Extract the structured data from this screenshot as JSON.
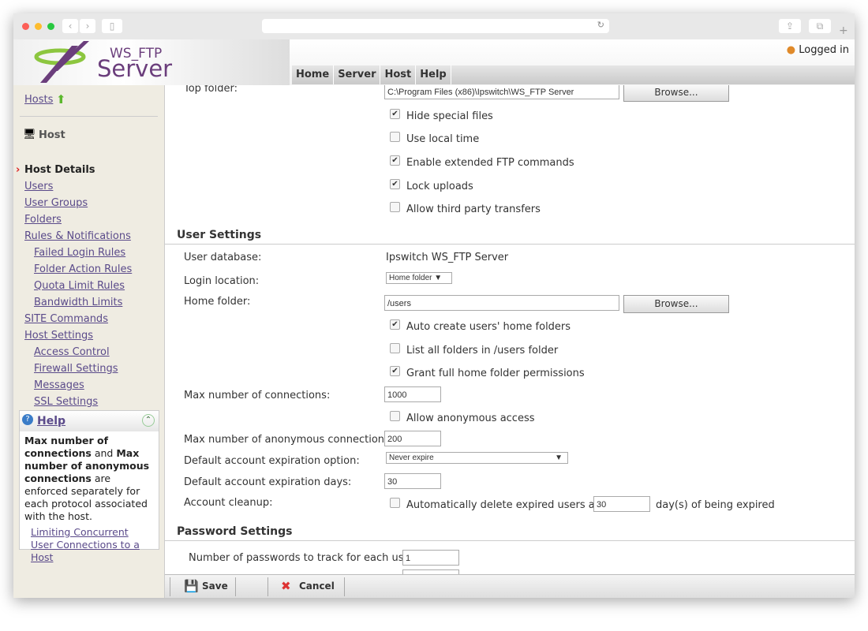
{
  "app": {
    "logo_line1": "WS_FTP",
    "logo_line2": "Server",
    "logged_in": "Logged in"
  },
  "nav": [
    "Home",
    "Server",
    "Host",
    "Help"
  ],
  "sidebar": {
    "hosts": "Hosts",
    "host_header": "Host",
    "items": [
      {
        "label": "Host Details",
        "level": 0,
        "current": true
      },
      {
        "label": "Users",
        "level": 0
      },
      {
        "label": "User Groups",
        "level": 0
      },
      {
        "label": "Folders",
        "level": 0
      },
      {
        "label": "Rules & Notifications",
        "level": 0
      },
      {
        "label": "Failed Login Rules",
        "level": 1
      },
      {
        "label": "Folder Action Rules",
        "level": 1
      },
      {
        "label": "Quota Limit Rules",
        "level": 1
      },
      {
        "label": "Bandwidth Limits",
        "level": 1
      },
      {
        "label": "SITE Commands",
        "level": 0
      },
      {
        "label": "Host Settings",
        "level": 0
      },
      {
        "label": "Access Control",
        "level": 1
      },
      {
        "label": "Firewall Settings",
        "level": 1
      },
      {
        "label": "Messages",
        "level": 1
      },
      {
        "label": "SSL Settings",
        "level": 1
      }
    ]
  },
  "help": {
    "title": "Help",
    "b1": "Max number of connections",
    "t1": " and ",
    "b2": "Max number of anonymous connections",
    "t2": " are enforced separately for each protocol associated with the host.",
    "link": "Limiting Concurrent User Connections to a Host"
  },
  "form": {
    "top_folder_label": "Top folder:",
    "top_folder_value": "C:\\Program Files (x86)\\Ipswitch\\WS_FTP Server",
    "browse": "Browse...",
    "top_checks": [
      {
        "label": "Hide special files",
        "checked": true
      },
      {
        "label": "Use local time",
        "checked": false
      },
      {
        "label": "Enable extended FTP commands",
        "checked": true
      },
      {
        "label": "Lock uploads",
        "checked": true
      },
      {
        "label": "Allow third party transfers",
        "checked": false
      }
    ],
    "user_settings": "User Settings",
    "user_db_label": "User database:",
    "user_db_value": "Ipswitch WS_FTP Server",
    "login_loc_label": "Login location:",
    "login_loc_value": "Home folder ▼",
    "home_folder_label": "Home folder:",
    "home_folder_value": "/users",
    "home_checks": [
      {
        "label": "Auto create users' home folders",
        "checked": true
      },
      {
        "label": "List all folders in /users folder",
        "checked": false
      },
      {
        "label": "Grant full home folder permissions",
        "checked": true
      }
    ],
    "max_conn_label": "Max number of connections:",
    "max_conn_value": "1000",
    "anon_label": "Allow anonymous access",
    "anon_checked": false,
    "max_anon_label": "Max number of anonymous connections:",
    "max_anon_value": "200",
    "exp_opt_label": "Default account expiration option:",
    "exp_opt_value": "Never expire",
    "exp_days_label": "Default account expiration days:",
    "exp_days_value": "30",
    "cleanup_label": "Account cleanup:",
    "cleanup_check": "Automatically delete expired users after",
    "cleanup_days": "30",
    "cleanup_suffix": "day(s) of being expired",
    "password_settings": "Password Settings",
    "pw_track_label": "Number of passwords to track for each user:",
    "pw_track_value": "1"
  },
  "footer": {
    "save": "Save",
    "cancel": "Cancel"
  }
}
